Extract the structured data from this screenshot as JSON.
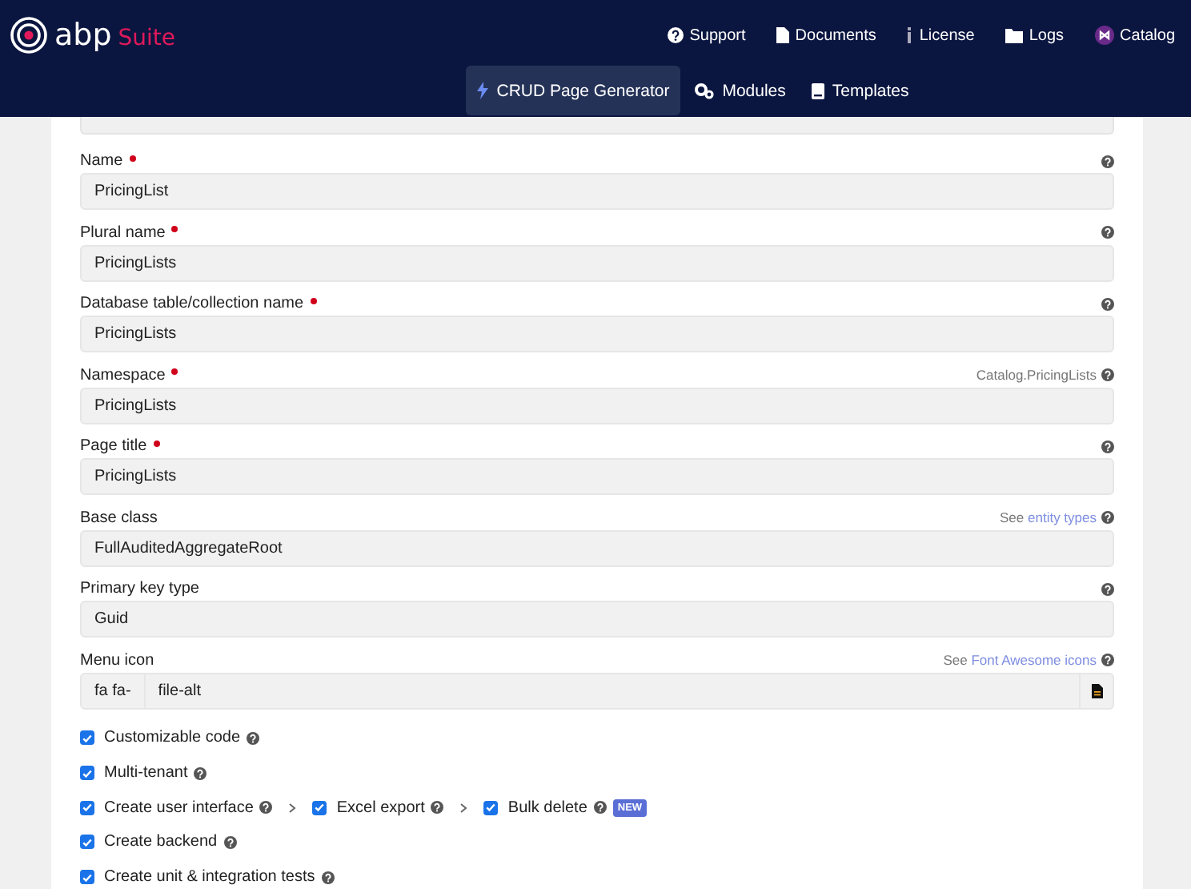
{
  "brand": {
    "name": "abp",
    "product": "Suite"
  },
  "top_nav": [
    {
      "label": "Support"
    },
    {
      "label": "Documents"
    },
    {
      "label": "License"
    },
    {
      "label": "Logs"
    },
    {
      "label": "Catalog"
    }
  ],
  "tabs": [
    {
      "label": "CRUD Page Generator",
      "selected": true
    },
    {
      "label": "Modules",
      "selected": false
    },
    {
      "label": "Templates",
      "selected": false
    }
  ],
  "fields": [
    {
      "label": "Name",
      "required": true,
      "value": "PricingList"
    },
    {
      "label": "Plural name",
      "required": true,
      "value": "PricingLists"
    },
    {
      "label": "Database table/collection name",
      "required": true,
      "value": "PricingLists"
    },
    {
      "label": "Namespace",
      "required": true,
      "value": "PricingLists",
      "hint": {
        "text": "Catalog.PricingLists"
      }
    },
    {
      "label": "Page title",
      "required": true,
      "value": "PricingLists"
    },
    {
      "label": "Base class",
      "required": false,
      "value": "FullAuditedAggregateRoot",
      "hint": {
        "text": "See",
        "link": "entity types"
      }
    },
    {
      "label": "Primary key type",
      "required": false,
      "value": "Guid"
    },
    {
      "label": "Menu icon",
      "required": false,
      "value": "file-alt",
      "prefix": "fa fa-",
      "hint": {
        "text": "See",
        "link": "Font Awesome icons"
      }
    }
  ],
  "options": [
    [
      {
        "label": "Customizable code",
        "checked": true
      }
    ],
    [
      {
        "label": "Multi-tenant",
        "checked": true
      }
    ],
    [
      {
        "label": "Create user interface",
        "checked": true
      },
      {
        "label": "Excel export",
        "checked": true
      },
      {
        "label": "Bulk delete",
        "checked": true,
        "badge": "NEW"
      }
    ],
    [
      {
        "label": "Create backend",
        "checked": true
      }
    ],
    [
      {
        "label": "Create unit & integration tests",
        "checked": true
      }
    ]
  ]
}
